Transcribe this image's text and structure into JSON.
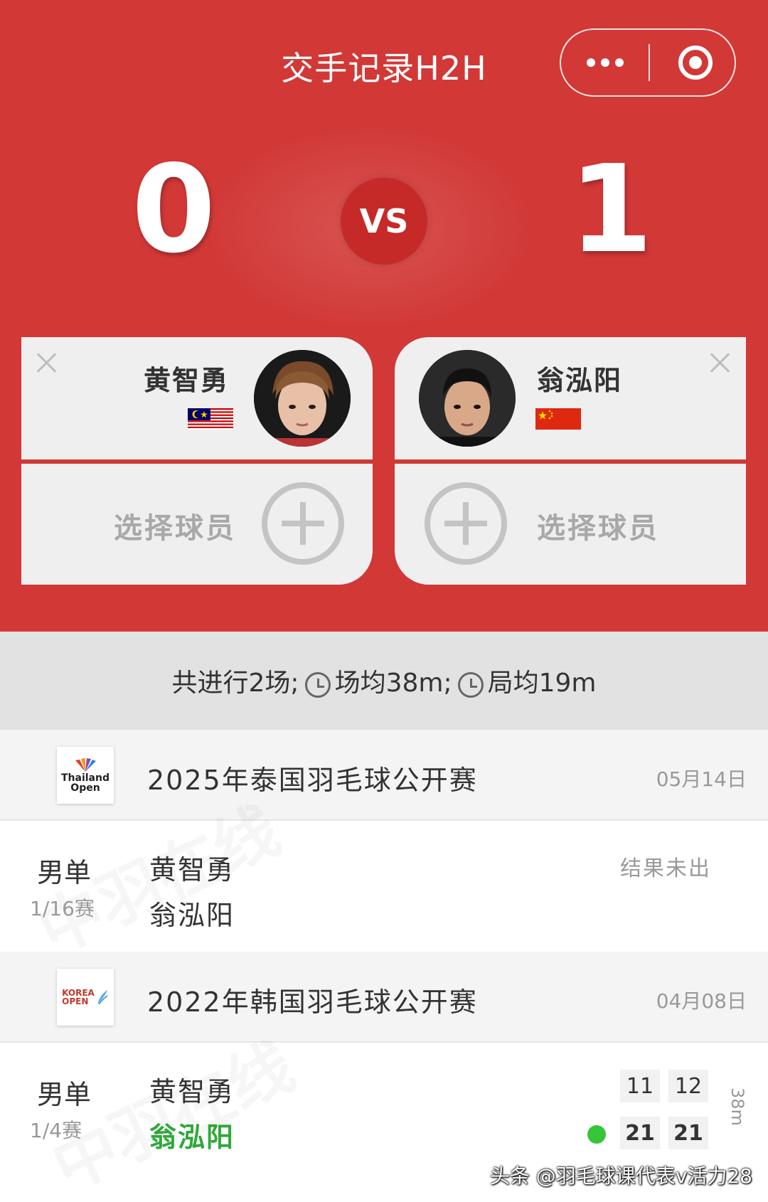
{
  "header": {
    "title": "交手记录H2H",
    "menu_icon": "more-dots-icon",
    "close_icon": "target-icon"
  },
  "scoreboard": {
    "left_score": "0",
    "vs_label": "VS",
    "right_score": "1"
  },
  "players": {
    "left": {
      "name": "黄智勇",
      "flag": "malaysia-flag",
      "select_label": "选择球员"
    },
    "right": {
      "name": "翁泓阳",
      "flag": "china-flag",
      "select_label": "选择球员"
    }
  },
  "summary": {
    "total": "共进行2场;",
    "avg_match": "场均38m;",
    "avg_game": "局均19m"
  },
  "events": [
    {
      "name": "2025年泰国羽毛球公开赛",
      "date": "05月14日",
      "logo_line1": "Thailand",
      "logo_line2": "Open",
      "match": {
        "category": "男单",
        "round": "1/16赛",
        "player1": "黄智勇",
        "player2": "翁泓阳",
        "status": "结果未出"
      }
    },
    {
      "name": "2022年韩国羽毛球公开赛",
      "date": "04月08日",
      "logo_line1": "KOREA",
      "logo_line2": "OPEN",
      "match": {
        "category": "男单",
        "round": "1/4赛",
        "player1": "黄智勇",
        "player2": "翁泓阳",
        "p1_scores": [
          "11",
          "12"
        ],
        "p2_scores": [
          "21",
          "21"
        ],
        "duration": "38m"
      }
    }
  ],
  "watermark": "中羽在线",
  "credit": "头条 @羽毛球课代表v活力28",
  "colors": {
    "primary_red": "#d13836",
    "winner_green": "#2fa83a"
  }
}
